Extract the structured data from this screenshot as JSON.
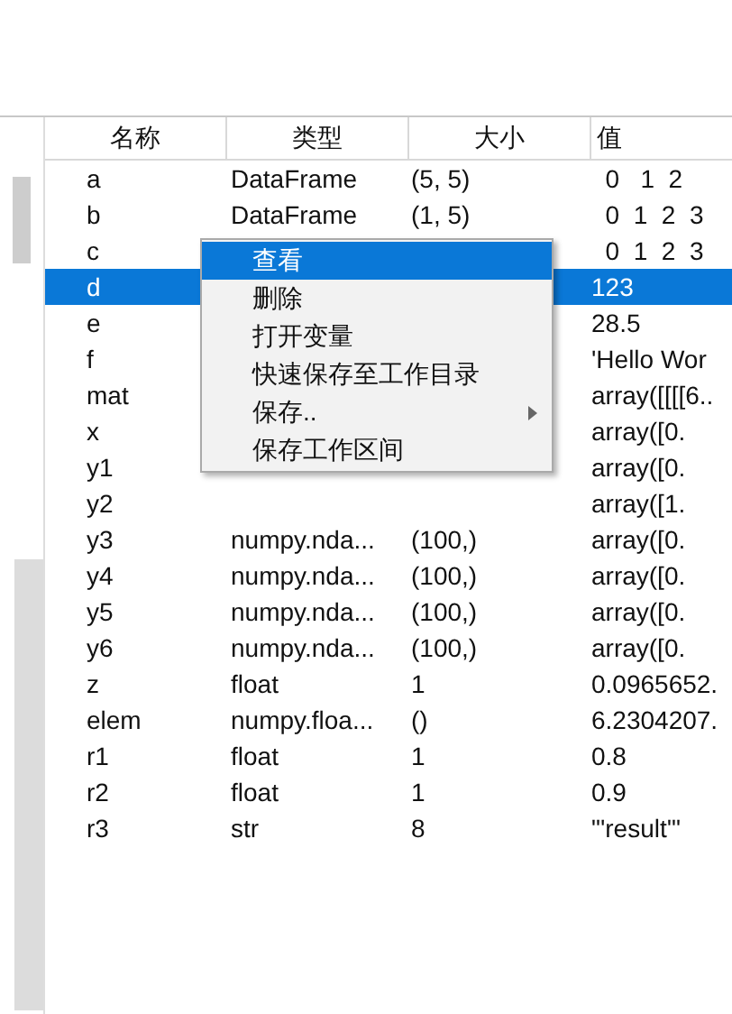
{
  "table": {
    "columns": [
      "名称",
      "类型",
      "大小",
      "值"
    ],
    "rows": [
      {
        "name": "a",
        "type": "DataFrame",
        "size": "(5, 5)",
        "value": "  0   1  2",
        "selected": false
      },
      {
        "name": "b",
        "type": "DataFrame",
        "size": "(1, 5)",
        "value": "  0  1  2  3",
        "selected": false
      },
      {
        "name": "c",
        "value": "  0  1  2  3",
        "selected": false
      },
      {
        "name": "d",
        "value": "123",
        "selected": true
      },
      {
        "name": "e",
        "value": "28.5",
        "selected": false
      },
      {
        "name": "f",
        "value": "'Hello Wor",
        "selected": false
      },
      {
        "name": "mat",
        "value": "array([[[[6..",
        "selected": false
      },
      {
        "name": "x",
        "value": "array([0.",
        "selected": false
      },
      {
        "name": "y1",
        "value": "array([0.",
        "selected": false
      },
      {
        "name": "y2",
        "value": "array([1.",
        "selected": false
      },
      {
        "name": "y3",
        "type": "numpy.nda...",
        "size": "(100,)",
        "value": "array([0.",
        "selected": false
      },
      {
        "name": "y4",
        "type": "numpy.nda...",
        "size": "(100,)",
        "value": "array([0.",
        "selected": false
      },
      {
        "name": "y5",
        "type": "numpy.nda...",
        "size": "(100,)",
        "value": "array([0.",
        "selected": false
      },
      {
        "name": "y6",
        "type": "numpy.nda...",
        "size": "(100,)",
        "value": "array([0.",
        "selected": false
      },
      {
        "name": "z",
        "type": "float",
        "size": "1",
        "value": "0.0965652.",
        "selected": false
      },
      {
        "name": "elem",
        "type": "numpy.floa...",
        "size": "()",
        "value": "6.2304207.",
        "selected": false
      },
      {
        "name": "r1",
        "type": "float",
        "size": "1",
        "value": "0.8",
        "selected": false
      },
      {
        "name": "r2",
        "type": "float",
        "size": "1",
        "value": "0.9",
        "selected": false
      },
      {
        "name": "r3",
        "type": "str",
        "size": "8",
        "value": "\"'result'\"",
        "selected": false
      }
    ]
  },
  "context_menu": {
    "items": [
      {
        "label": "查看",
        "selected": true,
        "submenu": false
      },
      {
        "label": "删除",
        "selected": false,
        "submenu": false
      },
      {
        "label": "打开变量",
        "selected": false,
        "submenu": false
      },
      {
        "label": "快速保存至工作目录",
        "selected": false,
        "submenu": false
      },
      {
        "label": "保存..",
        "selected": false,
        "submenu": true
      },
      {
        "label": "保存工作区间",
        "selected": false,
        "submenu": false
      }
    ]
  }
}
